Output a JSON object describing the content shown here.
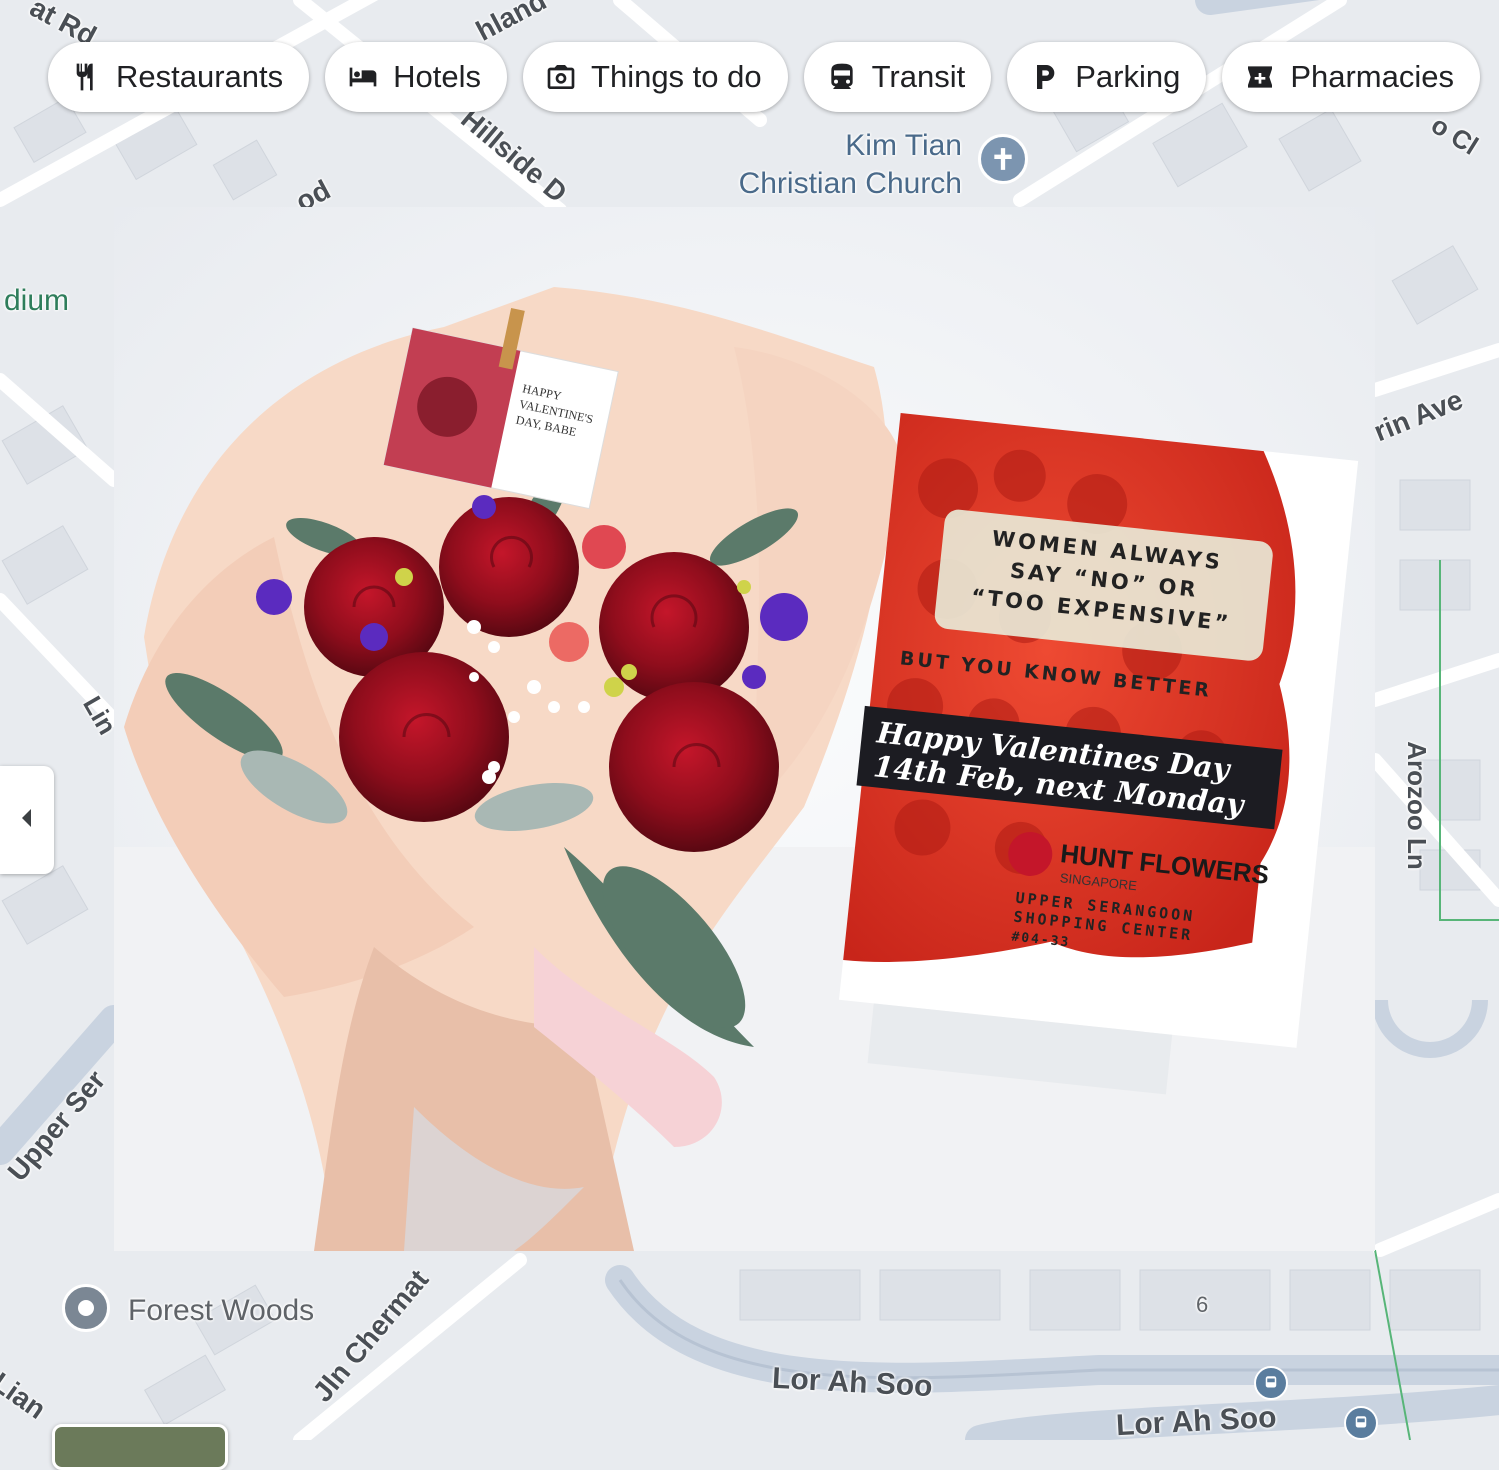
{
  "chips": [
    {
      "label": "Restaurants",
      "icon": "restaurant-icon"
    },
    {
      "label": "Hotels",
      "icon": "hotel-bed-icon"
    },
    {
      "label": "Things to do",
      "icon": "camera-icon"
    },
    {
      "label": "Transit",
      "icon": "train-icon"
    },
    {
      "label": "Parking",
      "icon": "parking-icon"
    },
    {
      "label": "Pharmacies",
      "icon": "pharmacy-icon"
    }
  ],
  "map": {
    "church": {
      "line1": "Kim Tian",
      "line2": "Christian Church",
      "icon": "church-cross-icon"
    },
    "poi_forest_woods": "Forest Woods",
    "partial_stadium": "dium",
    "roads": {
      "hillside": "Hillside D",
      "jln_chermat": "Jln Chermat",
      "lor_ah_soo_1": "Lor Ah Soo",
      "lor_ah_soo_2": "Lor Ah Soo",
      "arozoo_ln": "Arozoo Ln",
      "rin_ave": "rin Ave",
      "upper_ser": "Upper Ser",
      "lian": "Lian",
      "at_rd": "at Rd",
      "hland": "hland",
      "od": "od",
      "lin": "Lin",
      "ocl": "o Cl"
    },
    "block_number": "6",
    "colors": {
      "background": "#e8ebef",
      "road": "#ffffff",
      "major_road": "#c9d3e0",
      "block": "#dfe3e8"
    }
  },
  "photo": {
    "sign": {
      "line1": "WOMEN ALWAYS",
      "line2": "SAY “NO” OR",
      "line3": "“TOO EXPENSIVE”",
      "line4": "BUT YOU KNOW BETTER",
      "band1": "Happy Valentines Day",
      "band2": "14th Feb, next Monday",
      "brand": "HUNT FLOWERS",
      "brand_sub": "SINGAPORE",
      "addr1": "UPPER SERANGOON",
      "addr2": "SHOPPING CENTER",
      "addr3": "#04-33"
    },
    "tag": {
      "line1": "HAPPY",
      "line2": "VALENTINE'S",
      "line3": "DAY, BABE"
    }
  },
  "collapse": {
    "icon": "caret-left-icon"
  }
}
